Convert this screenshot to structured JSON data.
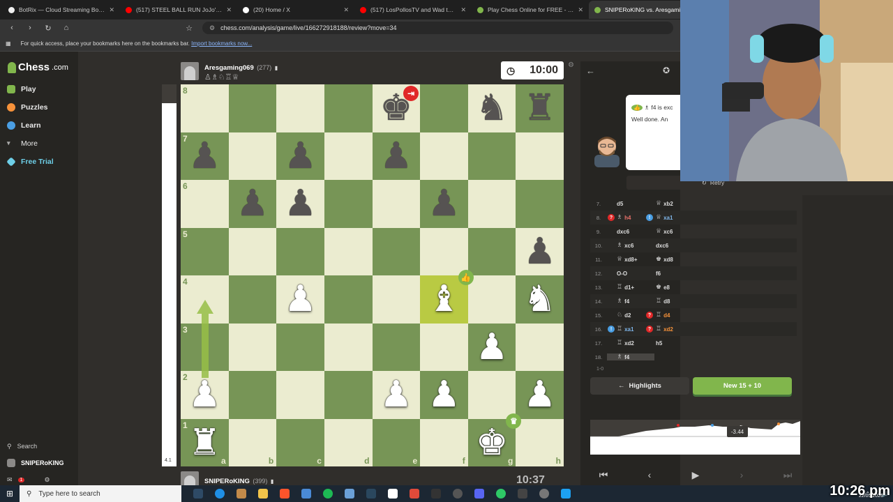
{
  "browser": {
    "tabs": [
      {
        "title": "BotRix — Cloud Streaming Bot for Tw",
        "favicon_color": "#f0f0f0"
      },
      {
        "title": "(517) STEEL BALL RUN JoJo's Bizarre",
        "favicon_color": "#ff0000"
      },
      {
        "title": "(20) Home / X",
        "favicon_color": "#ffffff"
      },
      {
        "title": "(517) LosPollosTV and Wad talk to u",
        "favicon_color": "#ff0000"
      },
      {
        "title": "Play Chess Online for FREE - 2 Player",
        "favicon_color": "#81b64c"
      },
      {
        "title": "SNIPERoKING vs. Aresgaming",
        "favicon_color": "#81b64c"
      }
    ],
    "url": "chess.com/analysis/game/live/166272918188/review?move=34",
    "bookmarks_text": "For quick access, place your bookmarks here on the bookmarks bar.",
    "bookmarks_link": "Import bookmarks now..."
  },
  "sidebar": {
    "logo": "Chess",
    "logo_suffix": ".com",
    "items": [
      {
        "label": "Play",
        "color": "#81b64c"
      },
      {
        "label": "Puzzles",
        "color": "#f7923a"
      },
      {
        "label": "Learn",
        "color": "#4a9ee3"
      },
      {
        "label": "More",
        "color": "#999999"
      },
      {
        "label": "Free Trial",
        "color": "#6ecfe8"
      }
    ],
    "search": "Search",
    "user": "SNIPERoKING",
    "notifications": "1"
  },
  "game": {
    "top_player": {
      "name": "Aresgaming069",
      "rating": "(277)"
    },
    "bottom_player": {
      "name": "SNIPERoKING",
      "rating": "(399)"
    },
    "top_clock": "10:00",
    "bottom_clock": "10:37",
    "eval_small": "4.1",
    "files": [
      "a",
      "b",
      "c",
      "d",
      "e",
      "f",
      "g",
      "h"
    ],
    "ranks": [
      "8",
      "7",
      "6",
      "5",
      "4",
      "3",
      "2",
      "1"
    ],
    "board": [
      [
        "",
        "",
        "",
        "",
        "bK",
        "",
        "bN",
        "bR"
      ],
      [
        "bP",
        "",
        "bP",
        "",
        "bP",
        "",
        "",
        ""
      ],
      [
        "",
        "bP",
        "bP",
        "",
        "",
        "bP",
        "",
        ""
      ],
      [
        "",
        "",
        "",
        "",
        "",
        "",
        "",
        "bP"
      ],
      [
        "",
        "",
        "wP",
        "",
        "",
        "wB",
        "",
        "wN"
      ],
      [
        "",
        "",
        "",
        "",
        "",
        "",
        "wP",
        ""
      ],
      [
        "wP",
        "",
        "",
        "",
        "wP",
        "wP",
        "",
        "wP"
      ],
      [
        "wR",
        "",
        "",
        "",
        "",
        "",
        "wK",
        ""
      ]
    ],
    "highlight_squares": [
      "f4"
    ]
  },
  "coach": {
    "line1": "f4 is exc",
    "line2": "Well done. An",
    "retry": "Retry"
  },
  "moves": [
    {
      "n": "7.",
      "w": "d5",
      "b": "xb2",
      "wp": "",
      "bp": "♕",
      "wa": "",
      "ba": ""
    },
    {
      "n": "8.",
      "w": "h4",
      "b": "xa1",
      "wp": "♗",
      "bp": "♕",
      "wa": "?",
      "ba": "!"
    },
    {
      "n": "9.",
      "w": "dxc6",
      "b": "xc6",
      "wp": "",
      "bp": "♕",
      "wa": "",
      "ba": ""
    },
    {
      "n": "10.",
      "w": "xc6",
      "b": "dxc6",
      "wp": "♗",
      "bp": "",
      "wa": "",
      "ba": ""
    },
    {
      "n": "11.",
      "w": "xd8+",
      "b": "xd8",
      "wp": "♕",
      "bp": "♚",
      "wa": "",
      "ba": ""
    },
    {
      "n": "12.",
      "w": "O-O",
      "b": "f6",
      "wp": "",
      "bp": "",
      "wa": "",
      "ba": ""
    },
    {
      "n": "13.",
      "w": "d1+",
      "b": "e8",
      "wp": "♖",
      "bp": "♚",
      "wa": "",
      "ba": ""
    },
    {
      "n": "14.",
      "w": "f4",
      "b": "d8",
      "wp": "♗",
      "bp": "♖",
      "wa": "",
      "ba": ""
    },
    {
      "n": "15.",
      "w": "d2",
      "b": "d4",
      "wp": "♘",
      "bp": "♖",
      "wa": "",
      "ba": "?"
    },
    {
      "n": "16.",
      "w": "xa1",
      "b": "xd2",
      "wp": "♖",
      "bp": "♖",
      "wa": "!",
      "ba": "?"
    },
    {
      "n": "17.",
      "w": "xd2",
      "b": "h5",
      "wp": "♖",
      "bp": "",
      "wa": "",
      "ba": ""
    },
    {
      "n": "18.",
      "w": "f4",
      "b": "",
      "wp": "♗",
      "bp": "",
      "wa": "",
      "ba": ""
    }
  ],
  "result": "1-0",
  "buttons": {
    "highlights": "Highlights",
    "new_game": "New 15 + 10"
  },
  "eval_graph": {
    "value": "-3.44"
  },
  "taskbar": {
    "search": "Type here to search"
  },
  "clock": {
    "time": "10:26 pm",
    "date": "22/05/2026"
  }
}
